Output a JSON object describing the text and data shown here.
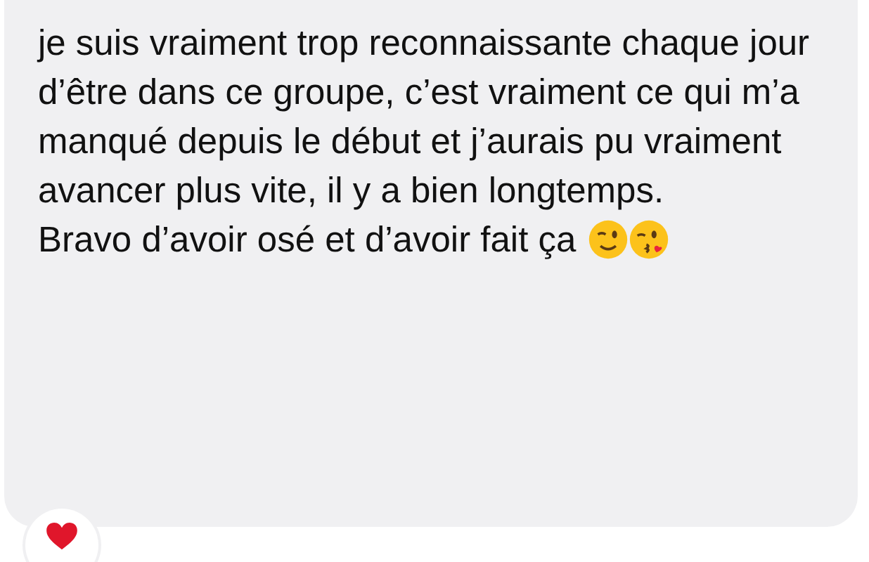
{
  "message": {
    "paragraphs": [
      "je suis vraiment trop reconnaissante chaque jour d’être dans ce groupe, c’est vraiment ce qui m’a manqué depuis le début et j’aurais pu vraiment avancer plus vite, il y a bien longtemps.",
      "Bravo d’avoir osé et d’avoir fait ça"
    ],
    "emojis": [
      {
        "kind": "wink"
      },
      {
        "kind": "kiss"
      }
    ],
    "reaction": {
      "kind": "heart"
    }
  }
}
